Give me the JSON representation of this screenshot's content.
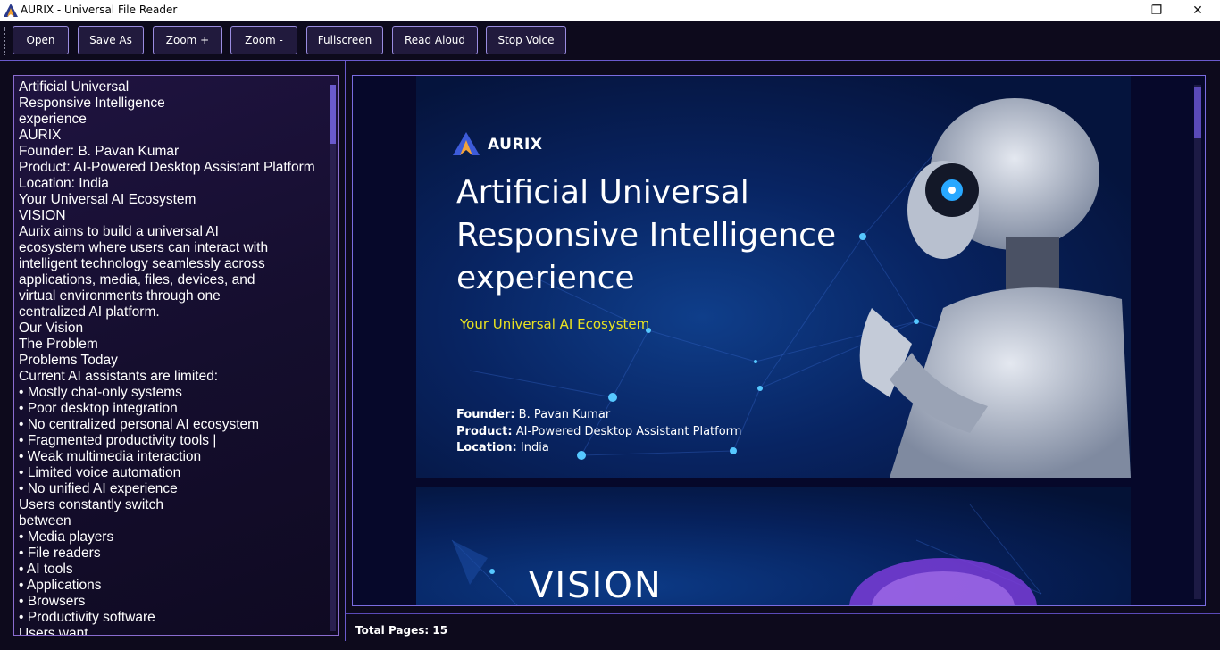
{
  "window": {
    "title": "AURIX - Universal File Reader",
    "minimize": "—",
    "restore": "❐",
    "close": "✕"
  },
  "toolbar": {
    "open": "Open",
    "save_as": "Save As",
    "zoom_in": "Zoom +",
    "zoom_out": "Zoom -",
    "fullscreen": "Fullscreen",
    "read_aloud": "Read Aloud",
    "stop_voice": "Stop Voice"
  },
  "text_panel": {
    "lines": [
      "Artificial Universal",
      "Responsive Intelligence",
      "experience",
      "AURIX",
      "Founder: B. Pavan Kumar",
      "Product: AI-Powered Desktop Assistant Platform",
      "Location: India",
      "Your Universal AI Ecosystem",
      "VISION",
      "Aurix aims to build a universal AI",
      "ecosystem where users can interact with",
      "intelligent technology seamlessly across",
      "applications, media, files, devices, and",
      "virtual environments through one",
      "centralized AI platform.",
      "Our Vision",
      "The Problem",
      "Problems Today",
      "Current AI assistants are limited:",
      "• Mostly chat-only systems",
      "• Poor desktop integration",
      "• No centralized personal AI ecosystem",
      "• Fragmented productivity tools |",
      "• Weak multimedia interaction",
      "• Limited voice automation",
      "• No unified AI experience",
      "Users constantly switch",
      "between",
      "• Media players",
      "• File readers",
      "• AI tools",
      "• Applications",
      "• Browsers",
      "• Productivity software",
      "Users want"
    ]
  },
  "slide1": {
    "brand": "AURIX",
    "title": "Artificial Universal\nResponsive Intelligence\nexperience",
    "subtitle": "Your Universal AI Ecosystem",
    "founder_label": "Founder:",
    "founder_value": "B. Pavan Kumar",
    "product_label": "Product:",
    "product_value": "AI-Powered Desktop Assistant Platform",
    "location_label": "Location:",
    "location_value": "India"
  },
  "slide2": {
    "title": "VISION"
  },
  "status": {
    "total_pages": "Total Pages: 15"
  },
  "colors": {
    "background": "#0d0a1c",
    "accent": "#6a5acd",
    "subtitle_yellow": "#e9e220"
  }
}
